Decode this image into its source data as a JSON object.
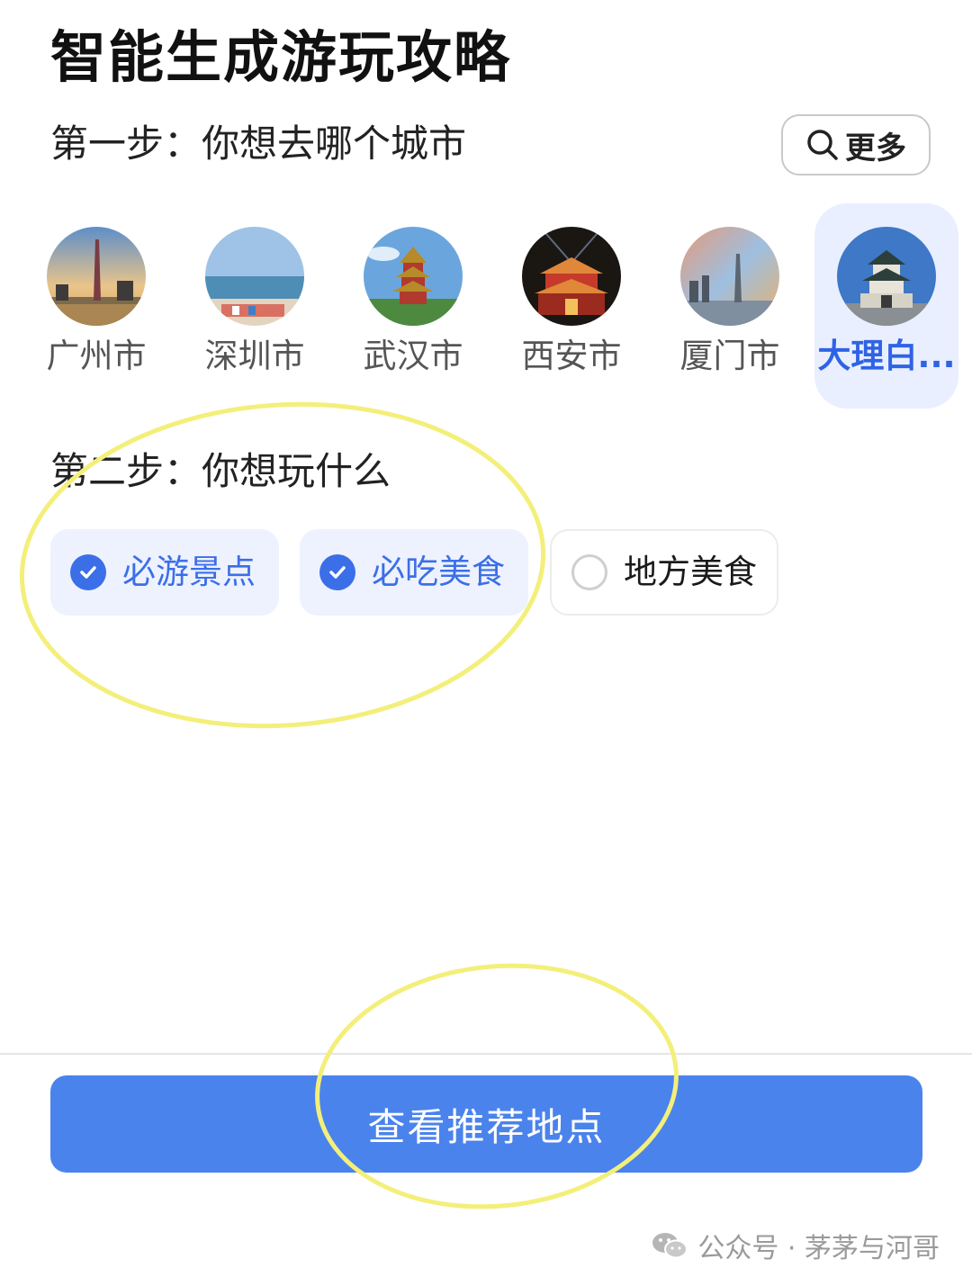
{
  "title": "智能生成游玩攻略",
  "step1": {
    "label": "第一步：你想去哪个城市",
    "more_label": "更多"
  },
  "cities": [
    {
      "name": "广州市",
      "selected": false
    },
    {
      "name": "深圳市",
      "selected": false
    },
    {
      "name": "武汉市",
      "selected": false
    },
    {
      "name": "西安市",
      "selected": false
    },
    {
      "name": "厦门市",
      "selected": false
    },
    {
      "name": "大理白...",
      "selected": true
    }
  ],
  "step2": {
    "label": "第二步：你想玩什么",
    "options": [
      {
        "label": "必游景点",
        "checked": true
      },
      {
        "label": "必吃美食",
        "checked": true
      },
      {
        "label": "地方美食",
        "checked": false
      }
    ]
  },
  "cta_label": "查看推荐地点",
  "watermark": "公众号 · 茅茅与河哥",
  "colors": {
    "accent": "#3b6fe8",
    "cta": "#4b83ec",
    "selected_bg": "#e9efff",
    "annotation": "#f3ef7a"
  },
  "icons": {
    "more": "search-icon",
    "checked": "checkmark-icon",
    "watermark": "wechat-icon"
  }
}
